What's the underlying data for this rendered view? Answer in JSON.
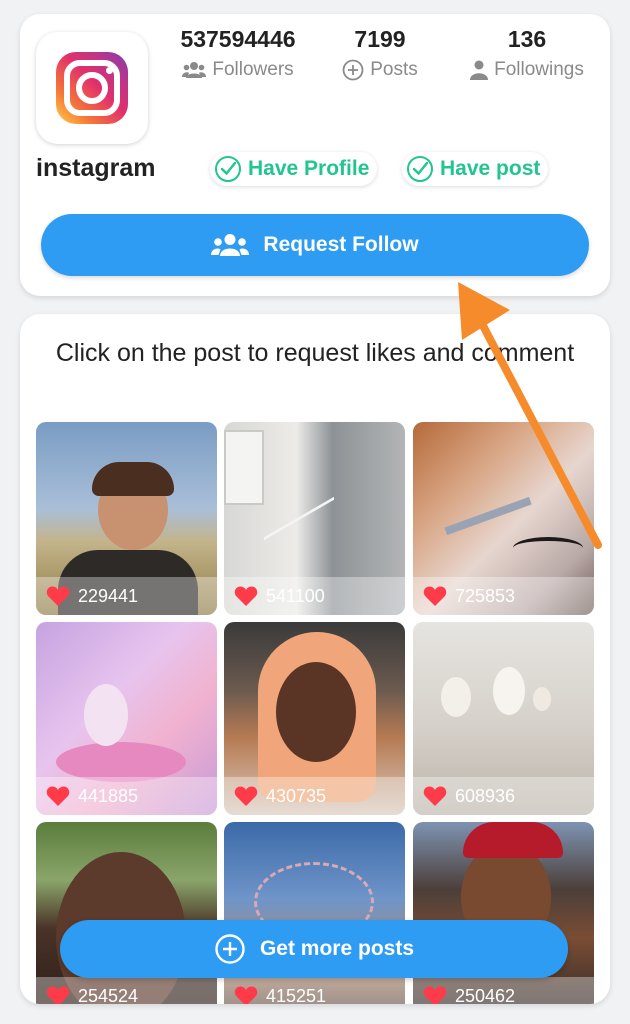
{
  "profile": {
    "username": "instagram",
    "stats": {
      "followers": {
        "value": "537594446",
        "label": "Followers",
        "icon": "followers-icon"
      },
      "posts": {
        "value": "7199",
        "label": "Posts",
        "icon": "plus-circle-icon"
      },
      "followings": {
        "value": "136",
        "label": "Followings",
        "icon": "person-icon"
      }
    },
    "badges": [
      {
        "label": "Have Profile",
        "icon": "check-circle-icon"
      },
      {
        "label": "Have post",
        "icon": "check-circle-icon"
      }
    ],
    "request_button": "Request Follow"
  },
  "posts_section": {
    "title": "Click on the post to request likes and comment",
    "posts": [
      {
        "likes": "229441"
      },
      {
        "likes": "541100"
      },
      {
        "likes": "725853"
      },
      {
        "likes": "441885"
      },
      {
        "likes": "430735"
      },
      {
        "likes": "608936"
      },
      {
        "likes": "254524"
      },
      {
        "likes": "415251"
      },
      {
        "likes": "250462"
      }
    ],
    "get_more_button": "Get more posts"
  },
  "colors": {
    "accent_blue": "#2e9cf2",
    "badge_green": "#22c58e",
    "heart_red": "#ff3b4a",
    "annotation_arrow": "#f68b2c"
  }
}
